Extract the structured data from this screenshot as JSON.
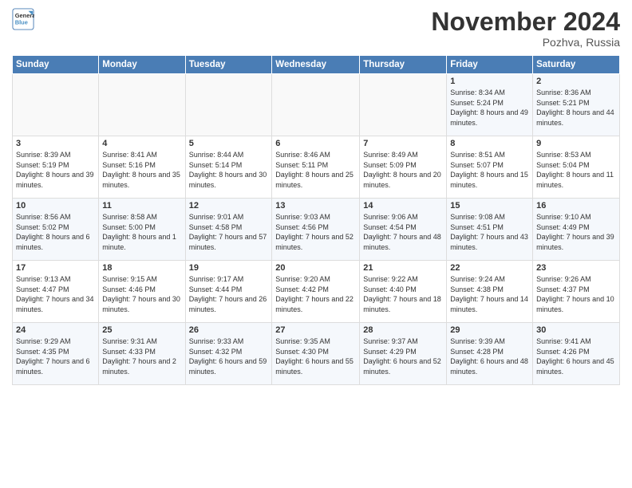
{
  "header": {
    "logo_line1": "General",
    "logo_line2": "Blue",
    "month": "November 2024",
    "location": "Pozhva, Russia"
  },
  "days_of_week": [
    "Sunday",
    "Monday",
    "Tuesday",
    "Wednesday",
    "Thursday",
    "Friday",
    "Saturday"
  ],
  "weeks": [
    [
      {
        "num": "",
        "info": ""
      },
      {
        "num": "",
        "info": ""
      },
      {
        "num": "",
        "info": ""
      },
      {
        "num": "",
        "info": ""
      },
      {
        "num": "",
        "info": ""
      },
      {
        "num": "1",
        "info": "Sunrise: 8:34 AM\nSunset: 5:24 PM\nDaylight: 8 hours and 49 minutes."
      },
      {
        "num": "2",
        "info": "Sunrise: 8:36 AM\nSunset: 5:21 PM\nDaylight: 8 hours and 44 minutes."
      }
    ],
    [
      {
        "num": "3",
        "info": "Sunrise: 8:39 AM\nSunset: 5:19 PM\nDaylight: 8 hours and 39 minutes."
      },
      {
        "num": "4",
        "info": "Sunrise: 8:41 AM\nSunset: 5:16 PM\nDaylight: 8 hours and 35 minutes."
      },
      {
        "num": "5",
        "info": "Sunrise: 8:44 AM\nSunset: 5:14 PM\nDaylight: 8 hours and 30 minutes."
      },
      {
        "num": "6",
        "info": "Sunrise: 8:46 AM\nSunset: 5:11 PM\nDaylight: 8 hours and 25 minutes."
      },
      {
        "num": "7",
        "info": "Sunrise: 8:49 AM\nSunset: 5:09 PM\nDaylight: 8 hours and 20 minutes."
      },
      {
        "num": "8",
        "info": "Sunrise: 8:51 AM\nSunset: 5:07 PM\nDaylight: 8 hours and 15 minutes."
      },
      {
        "num": "9",
        "info": "Sunrise: 8:53 AM\nSunset: 5:04 PM\nDaylight: 8 hours and 11 minutes."
      }
    ],
    [
      {
        "num": "10",
        "info": "Sunrise: 8:56 AM\nSunset: 5:02 PM\nDaylight: 8 hours and 6 minutes."
      },
      {
        "num": "11",
        "info": "Sunrise: 8:58 AM\nSunset: 5:00 PM\nDaylight: 8 hours and 1 minute."
      },
      {
        "num": "12",
        "info": "Sunrise: 9:01 AM\nSunset: 4:58 PM\nDaylight: 7 hours and 57 minutes."
      },
      {
        "num": "13",
        "info": "Sunrise: 9:03 AM\nSunset: 4:56 PM\nDaylight: 7 hours and 52 minutes."
      },
      {
        "num": "14",
        "info": "Sunrise: 9:06 AM\nSunset: 4:54 PM\nDaylight: 7 hours and 48 minutes."
      },
      {
        "num": "15",
        "info": "Sunrise: 9:08 AM\nSunset: 4:51 PM\nDaylight: 7 hours and 43 minutes."
      },
      {
        "num": "16",
        "info": "Sunrise: 9:10 AM\nSunset: 4:49 PM\nDaylight: 7 hours and 39 minutes."
      }
    ],
    [
      {
        "num": "17",
        "info": "Sunrise: 9:13 AM\nSunset: 4:47 PM\nDaylight: 7 hours and 34 minutes."
      },
      {
        "num": "18",
        "info": "Sunrise: 9:15 AM\nSunset: 4:46 PM\nDaylight: 7 hours and 30 minutes."
      },
      {
        "num": "19",
        "info": "Sunrise: 9:17 AM\nSunset: 4:44 PM\nDaylight: 7 hours and 26 minutes."
      },
      {
        "num": "20",
        "info": "Sunrise: 9:20 AM\nSunset: 4:42 PM\nDaylight: 7 hours and 22 minutes."
      },
      {
        "num": "21",
        "info": "Sunrise: 9:22 AM\nSunset: 4:40 PM\nDaylight: 7 hours and 18 minutes."
      },
      {
        "num": "22",
        "info": "Sunrise: 9:24 AM\nSunset: 4:38 PM\nDaylight: 7 hours and 14 minutes."
      },
      {
        "num": "23",
        "info": "Sunrise: 9:26 AM\nSunset: 4:37 PM\nDaylight: 7 hours and 10 minutes."
      }
    ],
    [
      {
        "num": "24",
        "info": "Sunrise: 9:29 AM\nSunset: 4:35 PM\nDaylight: 7 hours and 6 minutes."
      },
      {
        "num": "25",
        "info": "Sunrise: 9:31 AM\nSunset: 4:33 PM\nDaylight: 7 hours and 2 minutes."
      },
      {
        "num": "26",
        "info": "Sunrise: 9:33 AM\nSunset: 4:32 PM\nDaylight: 6 hours and 59 minutes."
      },
      {
        "num": "27",
        "info": "Sunrise: 9:35 AM\nSunset: 4:30 PM\nDaylight: 6 hours and 55 minutes."
      },
      {
        "num": "28",
        "info": "Sunrise: 9:37 AM\nSunset: 4:29 PM\nDaylight: 6 hours and 52 minutes."
      },
      {
        "num": "29",
        "info": "Sunrise: 9:39 AM\nSunset: 4:28 PM\nDaylight: 6 hours and 48 minutes."
      },
      {
        "num": "30",
        "info": "Sunrise: 9:41 AM\nSunset: 4:26 PM\nDaylight: 6 hours and 45 minutes."
      }
    ]
  ]
}
